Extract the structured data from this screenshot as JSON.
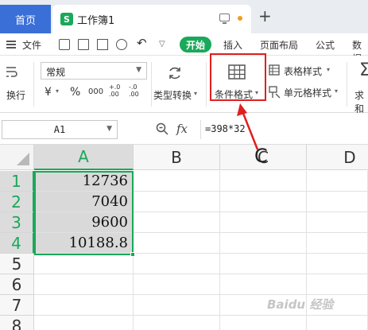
{
  "titlebar": {
    "home_tab": "首页",
    "doc_icon_letter": "S",
    "doc_title": "工作簿1",
    "new_tab_symbol": "+"
  },
  "menubar": {
    "file": "文件",
    "start": "开始",
    "insert": "插入",
    "page_layout": "页面布局",
    "formula": "公式",
    "data": "数据"
  },
  "ribbon": {
    "wrap_label": "换行",
    "number_format": "常规",
    "currency_symbol": "¥",
    "percent_symbol": "%",
    "thousands_symbol": "000",
    "inc_decimal": "+.0 .00",
    "dec_decimal": "-.0 .00",
    "type_convert": "类型转换",
    "conditional_format": "条件格式",
    "table_style": "表格样式",
    "cell_style": "单元格样式",
    "sum_label": "求和"
  },
  "formula_bar": {
    "name_box": "A1",
    "fx_label": "fx",
    "formula": "=398*32"
  },
  "grid": {
    "columns": [
      "A",
      "B",
      "C",
      "D"
    ],
    "rows": [
      "1",
      "2",
      "3",
      "4",
      "5",
      "6",
      "7",
      "8"
    ],
    "values": [
      "12736",
      "7040",
      "9600",
      "10188.8"
    ]
  },
  "annotation": {
    "label": "C"
  },
  "watermark": "Baidu 经验",
  "colors": {
    "accent_green": "#1aa85a",
    "home_tab_blue": "#3a6fd8",
    "highlight_red": "#e02020"
  }
}
